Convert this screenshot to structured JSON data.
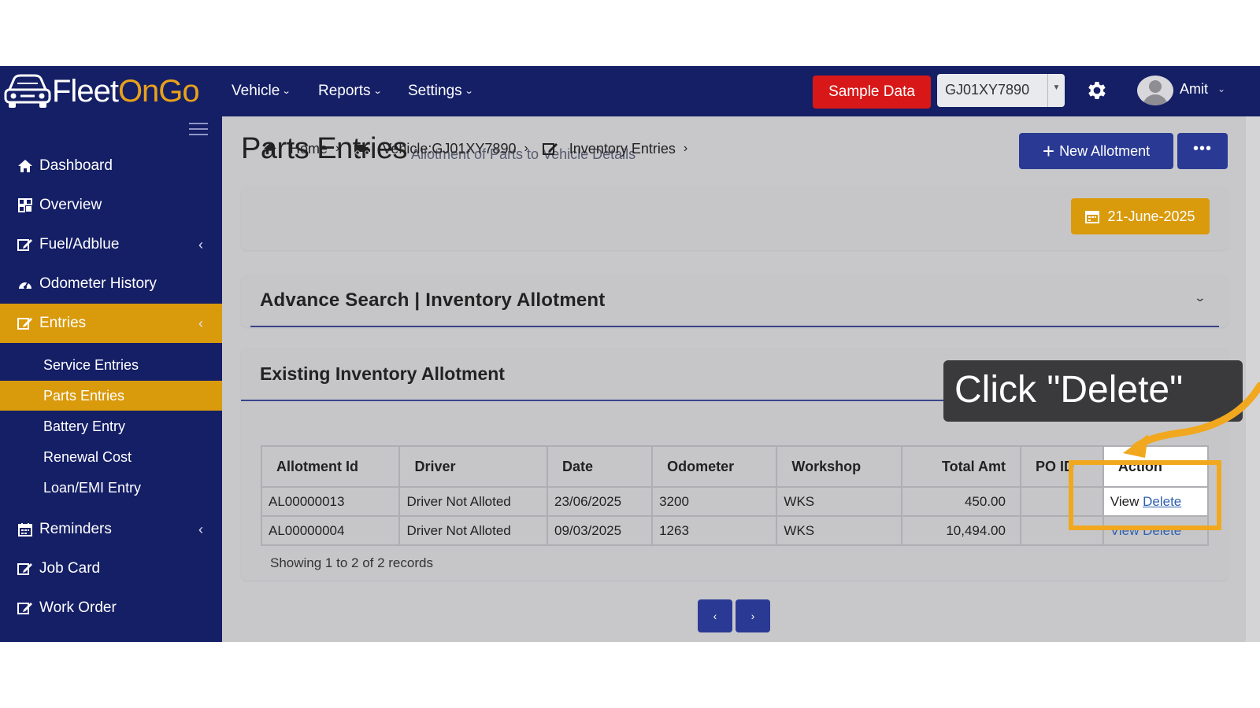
{
  "app": {
    "logo_white": "Fleet",
    "logo_orange": "OnGo",
    "accent_color": "#d99a0c",
    "nav_color": "#151f66"
  },
  "topnav": {
    "menus": [
      "Vehicle",
      "Reports",
      "Settings"
    ],
    "sample_data_label": "Sample Data",
    "vehicle_select_value": "GJ01XY7890",
    "user_name": "Amit"
  },
  "sidebar": {
    "items": [
      {
        "label": "Dashboard",
        "icon": "home-icon"
      },
      {
        "label": "Overview",
        "icon": "grid-icon"
      },
      {
        "label": "Fuel/Adblue",
        "icon": "edit-icon",
        "chevron": "‹"
      },
      {
        "label": "Odometer History",
        "icon": "gauge-icon"
      },
      {
        "label": "Entries",
        "icon": "edit-icon",
        "chevron": "‹",
        "active": true
      },
      {
        "label": "Reminders",
        "icon": "calendar-icon",
        "chevron": "‹"
      },
      {
        "label": "Job Card",
        "icon": "edit-icon"
      },
      {
        "label": "Work Order",
        "icon": "edit-icon"
      }
    ],
    "entries_submenu": [
      {
        "label": "Service Entries"
      },
      {
        "label": "Parts Entries",
        "active": true
      },
      {
        "label": "Battery Entry"
      },
      {
        "label": "Renewal Cost"
      },
      {
        "label": "Loan/EMI Entry"
      }
    ]
  },
  "page": {
    "title": "Parts Entries",
    "subtitle": "Allotment of Parts to Vehicle Details",
    "new_button_label": "New Allotment",
    "more_button_label": "•••",
    "breadcrumb": [
      "Home",
      "Vehicle:GJ01XY7890",
      "Inventory Entries"
    ],
    "date_label": "21-June-2025"
  },
  "advance_search": {
    "title": "Advance Search | Inventory Allotment"
  },
  "existing": {
    "title": "Existing Inventory Allotment",
    "columns": [
      "Allotment Id",
      "Driver",
      "Date",
      "Odometer",
      "Workshop",
      "Total Amt",
      "PO ID",
      "Action"
    ],
    "rows": [
      {
        "id": "AL00000013",
        "driver": "Driver Not Alloted",
        "date": "23/06/2025",
        "odometer": "3200",
        "workshop": "WKS",
        "total": "450.00",
        "po": "",
        "view": "View",
        "delete": "Delete"
      },
      {
        "id": "AL00000004",
        "driver": "Driver Not Alloted",
        "date": "09/03/2025",
        "odometer": "1263",
        "workshop": "WKS",
        "total": "10,494.00",
        "po": "",
        "view": "View",
        "delete": "Delete"
      }
    ],
    "records_text": "Showing 1 to 2 of 2 records",
    "prev_label": "‹",
    "next_label": "›"
  },
  "tutorial": {
    "callout_text": "Click \"Delete\"",
    "highlight_color": "#f1a81e"
  }
}
